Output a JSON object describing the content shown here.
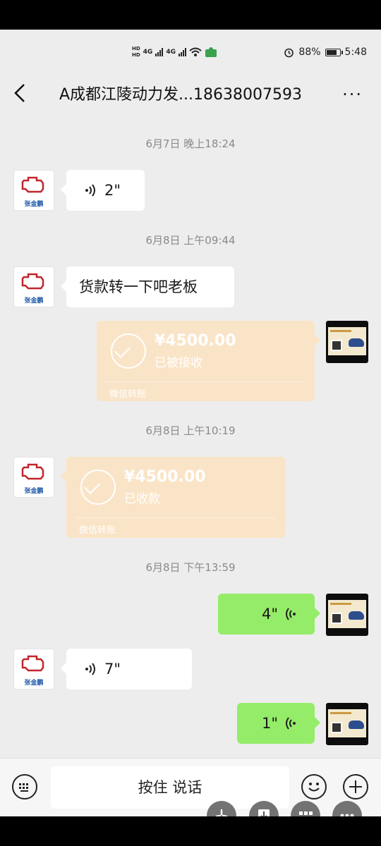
{
  "status_bar": {
    "hd1": "HD",
    "hd2": "HD",
    "net1": "4G",
    "net2": "4G",
    "battery": "88%",
    "time": "5:48",
    "battery_level": 0.88
  },
  "header": {
    "title": "A成都江陵动力发...18638007593",
    "more": "···"
  },
  "contact": {
    "avatar_label": "张金鹏"
  },
  "messages": {
    "t1": "6月7日 晚上18:24",
    "voice1": "2\"",
    "t2": "6月8日 上午09:44",
    "text1": "货款转一下吧老板",
    "transfer1": {
      "amount": "¥4500.00",
      "status": "已被接收",
      "footer": "微信转账"
    },
    "t3": "6月8日 上午10:19",
    "transfer2": {
      "amount": "¥4500.00",
      "status": "已收款",
      "footer": "微信转账"
    },
    "t4": "6月8日 下午13:59",
    "voice2": "4\"",
    "voice3": "7\"",
    "voice4": "1\""
  },
  "input": {
    "hold_to_talk": "按住 说话"
  },
  "colors": {
    "sent_bubble": "#95ec69",
    "transfer": "#fae4c7",
    "background": "#ededed"
  }
}
